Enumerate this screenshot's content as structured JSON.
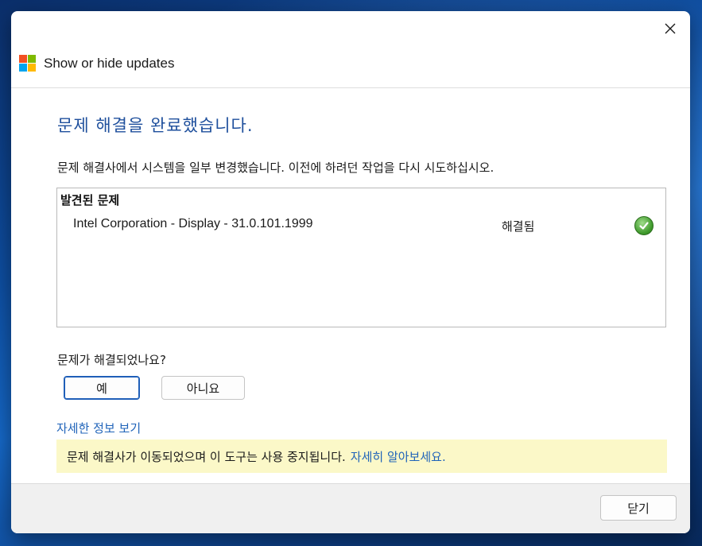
{
  "window": {
    "title": "Show or hide updates",
    "close_icon": "close-icon"
  },
  "main": {
    "heading": "문제 해결을 완료했습니다.",
    "description": "문제 해결사에서 시스템을 일부 변경했습니다. 이전에 하려던 작업을 다시 시도하십시오.",
    "issues_header": "발견된 문제",
    "issues": [
      {
        "name": "Intel Corporation - Display - 31.0.101.1999",
        "status": "해결됨",
        "icon": "check-icon"
      }
    ],
    "question": "문제가 해결되었나요?",
    "yes_label": "예",
    "no_label": "아니요",
    "details_link": "자세한 정보 보기",
    "notice_text": "문제 해결사가 이동되었으며 이 도구는 사용 중지됩니다.",
    "notice_link": "자세히 알아보세요."
  },
  "footer": {
    "close_label": "닫기"
  },
  "colors": {
    "heading": "#1e4f9c",
    "link": "#1f63b9",
    "notice_bg": "#fbf8c8",
    "logo": [
      "#f25022",
      "#7fba00",
      "#00a4ef",
      "#ffb900"
    ]
  }
}
